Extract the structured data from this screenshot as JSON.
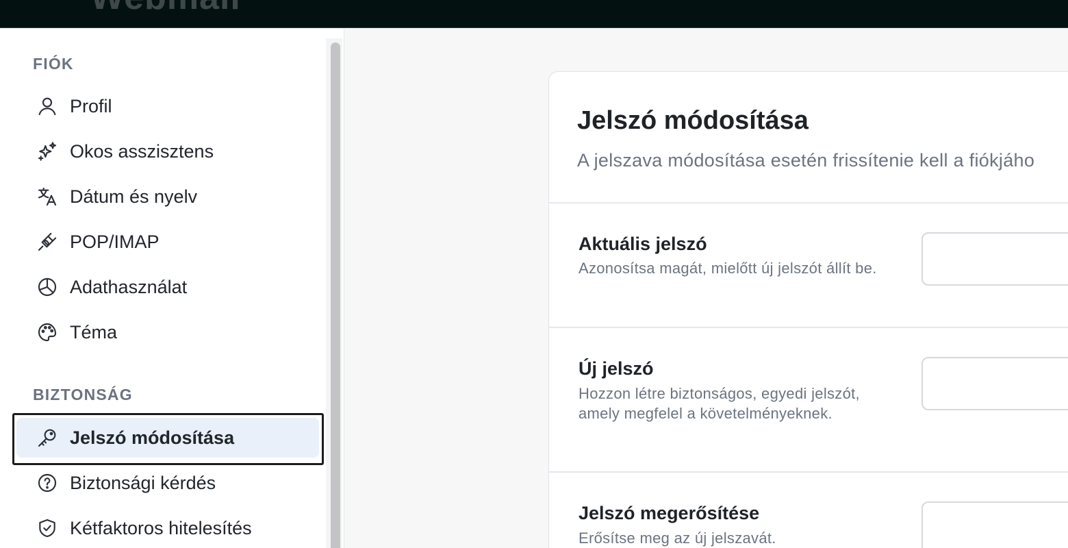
{
  "app": {
    "brand": "Webmail"
  },
  "sidebar": {
    "sections": [
      {
        "title": "FIÓK",
        "items": [
          {
            "label": "Profil",
            "icon": "user-icon"
          },
          {
            "label": "Okos asszisztens",
            "icon": "sparkles-icon"
          },
          {
            "label": "Dátum és nyelv",
            "icon": "translate-icon"
          },
          {
            "label": "POP/IMAP",
            "icon": "plug-icon"
          },
          {
            "label": "Adathasználat",
            "icon": "pie-chart-icon"
          },
          {
            "label": "Téma",
            "icon": "palette-icon"
          }
        ]
      },
      {
        "title": "BIZTONSÁG",
        "items": [
          {
            "label": "Jelszó módosítása",
            "icon": "key-icon",
            "active": true
          },
          {
            "label": "Biztonsági kérdés",
            "icon": "question-circle-icon"
          },
          {
            "label": "Kétfaktoros hitelesítés",
            "icon": "shield-check-icon"
          }
        ]
      }
    ]
  },
  "main": {
    "card": {
      "title": "Jelszó módosítása",
      "subtitle": "A jelszava módosítása esetén frissítenie kell a fiókjáho",
      "fields": [
        {
          "label": "Aktuális jelszó",
          "description": "Azonosítsa magát, mielőtt új jelszót állít be.",
          "value": ""
        },
        {
          "label": "Új jelszó",
          "description": "Hozzon létre biztonságos, egyedi jelszót, amely megfelel a követelményeknek.",
          "value": ""
        },
        {
          "label": "Jelszó megerősítése",
          "description": "Erősítse meg az új jelszavát.",
          "value": ""
        }
      ]
    }
  }
}
